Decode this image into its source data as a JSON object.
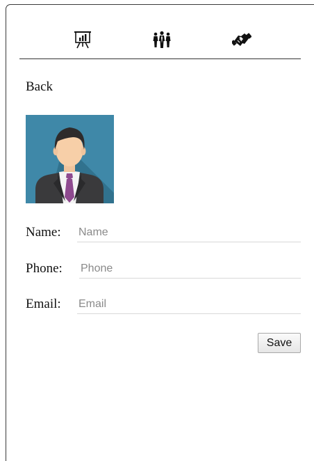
{
  "toolbar": {
    "icons": [
      "presentation-chart-icon",
      "team-people-icon",
      "handshake-icon"
    ]
  },
  "nav": {
    "back_label": "Back"
  },
  "profile": {
    "avatar": "user-avatar-businessman"
  },
  "form": {
    "name_label": "Name:",
    "name_placeholder": "Name",
    "name_value": "",
    "phone_label": "Phone:",
    "phone_placeholder": "Phone",
    "phone_value": "",
    "email_label": "Email:",
    "email_placeholder": "Email",
    "email_value": "",
    "save_label": "Save"
  },
  "colors": {
    "avatar_bg": "#3f88a8",
    "tie": "#8e4a8f",
    "divider": "#333333"
  }
}
